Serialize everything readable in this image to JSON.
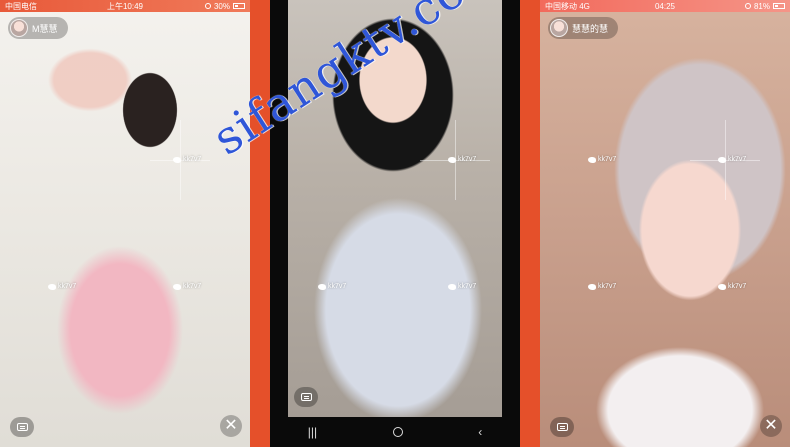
{
  "panels": [
    {
      "status": {
        "carrier": "中国电信",
        "time": "上午10:49",
        "battery": "30%"
      },
      "user": {
        "name": "M慧慧"
      },
      "watermark": "kk7v7"
    },
    {
      "watermark": "kk7v7",
      "navbar": {
        "recents": "|||",
        "back": "‹"
      }
    },
    {
      "status": {
        "carrier": "中国移动 4G",
        "time": "04:25",
        "battery": "81%"
      },
      "user": {
        "name": "慧慧的慧"
      },
      "watermark": "kk7v7"
    }
  ],
  "site_watermark": "sifangktv.com",
  "controls": {
    "close": "✕"
  },
  "colors": {
    "background": "#e5502a",
    "site_watermark": "#2f56d8"
  }
}
